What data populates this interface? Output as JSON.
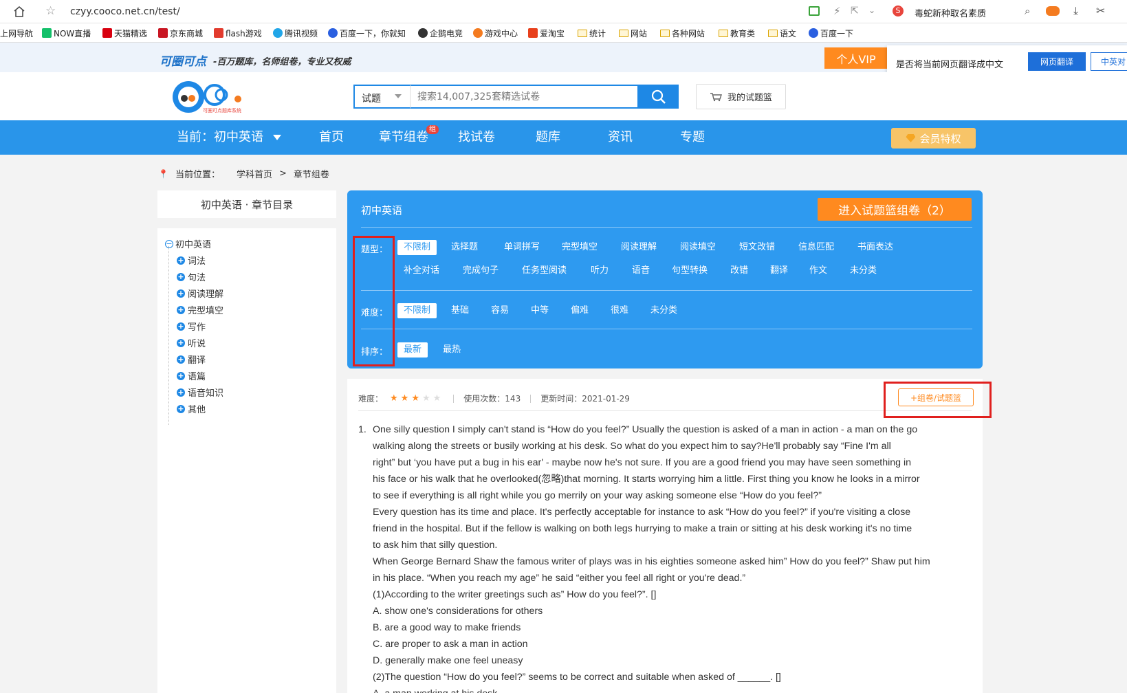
{
  "browser": {
    "url": "czyy.cooco.net.cn/test/",
    "search_hint": "毒蛇新种取名素质",
    "bookmarks": [
      "上网导航",
      "NOW直播",
      "天猫精选",
      "京东商城",
      "flash游戏",
      "腾讯视频",
      "百度一下，你就知",
      "企鹅电竞",
      "游戏中心",
      "爱淘宝",
      "统计",
      "网站",
      "各种网站",
      "教育类",
      "语文",
      "百度一下"
    ]
  },
  "site": {
    "brand": "可圈可点",
    "slogan": "-百万题库，名师组卷，专业又权威",
    "vip": "个人VIP",
    "translate_prompt": "是否将当前网页翻译成中文",
    "translate_btn": "网页翻译",
    "translate_alt": "中英对",
    "logo_caption": "可圈可点题库系统"
  },
  "search": {
    "type": "试题",
    "placeholder": "搜索14,007,325套精选试卷",
    "basket": "我的试题篮"
  },
  "nav": {
    "current": "当前：初中英语",
    "items": [
      "首页",
      "章节组卷",
      "找试卷",
      "题库",
      "资讯",
      "专题"
    ],
    "badge": "组",
    "member": "会员特权"
  },
  "breadcrumb": {
    "label": "当前位置：",
    "items": [
      "学科首页",
      "章节组卷"
    ],
    "sep": ">"
  },
  "sidebar": {
    "title": "初中英语 · 章节目录",
    "root": "初中英语",
    "items": [
      "词法",
      "句法",
      "阅读理解",
      "完型填空",
      "写作",
      "听说",
      "翻译",
      "语篇",
      "语音知识",
      "其他"
    ]
  },
  "filter": {
    "subject": "初中英语",
    "enter_btn": "进入试题篮组卷（2）",
    "type_label": "题型：",
    "types_row1": [
      "不限制",
      "选择题",
      "单词拼写",
      "完型填空",
      "阅读理解",
      "阅读填空",
      "短文改错",
      "信息匹配",
      "书面表达"
    ],
    "types_row2": [
      "补全对话",
      "完成句子",
      "任务型阅读",
      "听力",
      "语音",
      "句型转换",
      "改错",
      "翻译",
      "作文",
      "未分类"
    ],
    "difficulty_label": "难度：",
    "difficulties": [
      "不限制",
      "基础",
      "容易",
      "中等",
      "偏难",
      "很难",
      "未分类"
    ],
    "sort_label": "排序：",
    "sorts": [
      "最新",
      "最热"
    ]
  },
  "question": {
    "difficulty_label": "难度：",
    "stars_filled": 3,
    "stars_total": 5,
    "usage": "使用次数：143",
    "updated": "更新时间：2021-01-29",
    "add_btn": "+组卷/试题篮",
    "number": "1.",
    "lines": [
      "One silly question I simply can't stand is “How do you feel?” Usually the question is asked of a man in action - a man on the go",
      "walking along the streets or busily working at his desk. So what do you expect him to say?He'll probably say “Fine I'm all",
      "right” but ‘you have put a bug in his ear' - maybe now he's not sure. If you are a good friend you may have seen something in",
      "his face or his walk that he overlooked(忽略)that morning. It starts worrying him a little. First thing you know he looks in a mirror",
      "to see if everything is all right while you go merrily on your way asking someone else “How do you feel?”",
      "Every question has its time and place. It's perfectly acceptable for instance to ask “How do you feel?” if you're visiting a close",
      "friend in the hospital. But if the fellow is walking on both legs hurrying to make a train or sitting at his desk working it's no time",
      "to ask him that silly question.",
      "When George Bernard Shaw the famous writer of plays was in his eighties someone asked him” How do you feel?” Shaw put him",
      "in his place. “When you reach my age” he said “either you feel all right or you're dead.”",
      "(1)According to the writer greetings such as” How do you feel?”. []",
      "A. show one's considerations for others",
      "B. are a good way to make friends",
      "C. are proper to ask a man in action",
      "D. generally make one feel uneasy",
      "(2)The question “How do you feel?” seems to be correct and suitable when asked of ______. []",
      "A. a man working at his desk"
    ]
  },
  "colors": {
    "primary": "#2995ea",
    "accent": "#ff8a1f",
    "highlight": "#e0201e"
  }
}
